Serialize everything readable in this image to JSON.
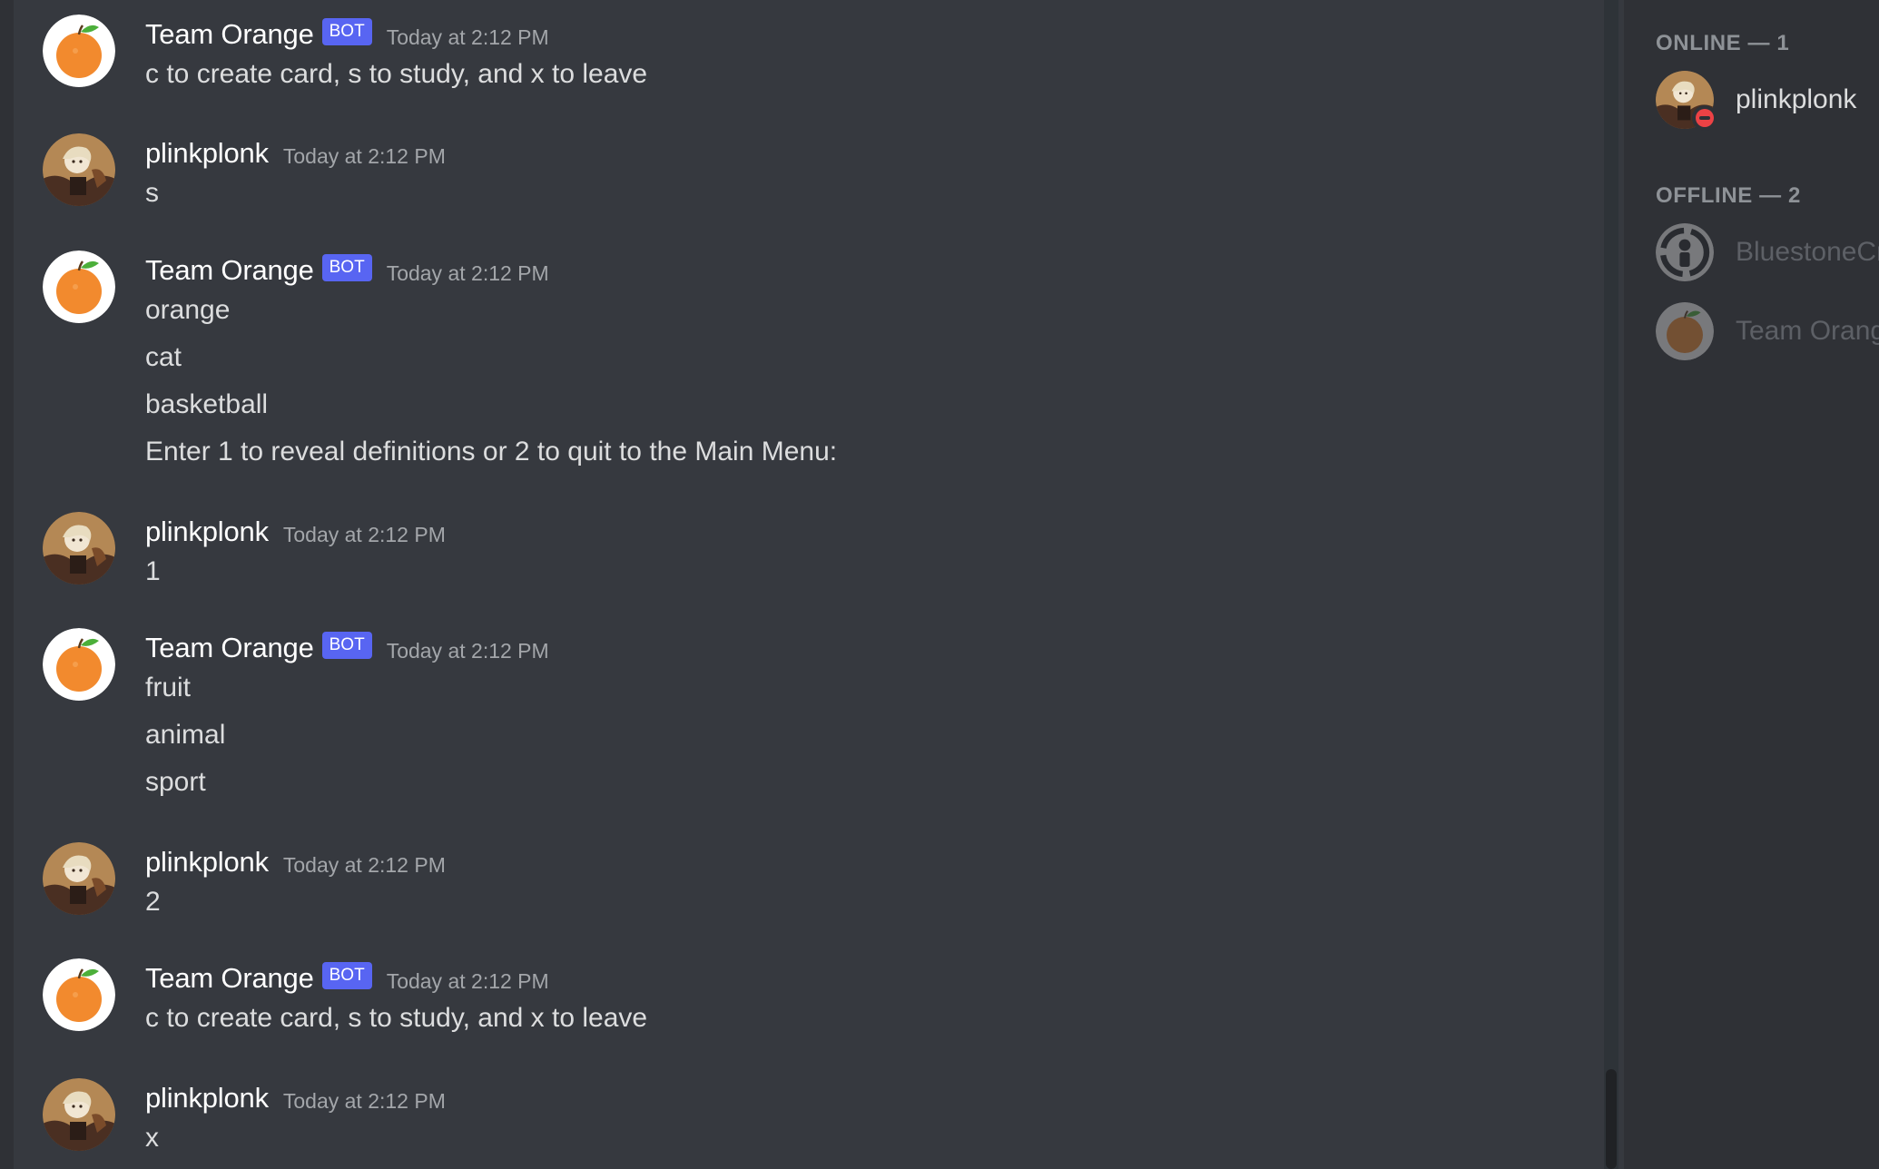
{
  "messages": [
    {
      "author": "Team Orange",
      "is_bot": true,
      "badge": "BOT",
      "timestamp": "Today at 2:12 PM",
      "avatar": "orange-avatar-icon",
      "lines": [
        "c to create card, s to study, and x to leave"
      ]
    },
    {
      "author": "plinkplonk",
      "is_bot": false,
      "timestamp": "Today at 2:12 PM",
      "avatar": "user-avatar-icon",
      "lines": [
        "s"
      ]
    },
    {
      "author": "Team Orange",
      "is_bot": true,
      "badge": "BOT",
      "timestamp": "Today at 2:12 PM",
      "avatar": "orange-avatar-icon",
      "lines": [
        "orange",
        "cat",
        "basketball",
        "Enter 1 to reveal definitions or 2 to quit to the Main Menu:"
      ]
    },
    {
      "author": "plinkplonk",
      "is_bot": false,
      "timestamp": "Today at 2:12 PM",
      "avatar": "user-avatar-icon",
      "lines": [
        "1"
      ]
    },
    {
      "author": "Team Orange",
      "is_bot": true,
      "badge": "BOT",
      "timestamp": "Today at 2:12 PM",
      "avatar": "orange-avatar-icon",
      "lines": [
        "fruit",
        "animal",
        "sport"
      ]
    },
    {
      "author": "plinkplonk",
      "is_bot": false,
      "timestamp": "Today at 2:12 PM",
      "avatar": "user-avatar-icon",
      "lines": [
        "2"
      ]
    },
    {
      "author": "Team Orange",
      "is_bot": true,
      "badge": "BOT",
      "timestamp": "Today at 2:12 PM",
      "avatar": "orange-avatar-icon",
      "lines": [
        "c to create card, s to study, and x to leave"
      ]
    },
    {
      "author": "plinkplonk",
      "is_bot": false,
      "timestamp": "Today at 2:12 PM",
      "avatar": "user-avatar-icon",
      "lines": [
        "x"
      ]
    }
  ],
  "members": {
    "online_heading": "ONLINE — 1",
    "offline_heading": "OFFLINE — 2",
    "online": [
      {
        "name": "plinkplonk",
        "status": "do-not-disturb",
        "avatar": "user-avatar-icon"
      }
    ],
    "offline": [
      {
        "name": "BluestoneCr",
        "avatar": "default-avatar-icon"
      },
      {
        "name": "Team Orang",
        "avatar": "orange-avatar-icon"
      }
    ]
  },
  "colors": {
    "background": "#36393f",
    "sidebar": "#2f3136",
    "bot_badge": "#5865f2",
    "dnd_status": "#ed4245",
    "orange": "#f28a2e"
  }
}
